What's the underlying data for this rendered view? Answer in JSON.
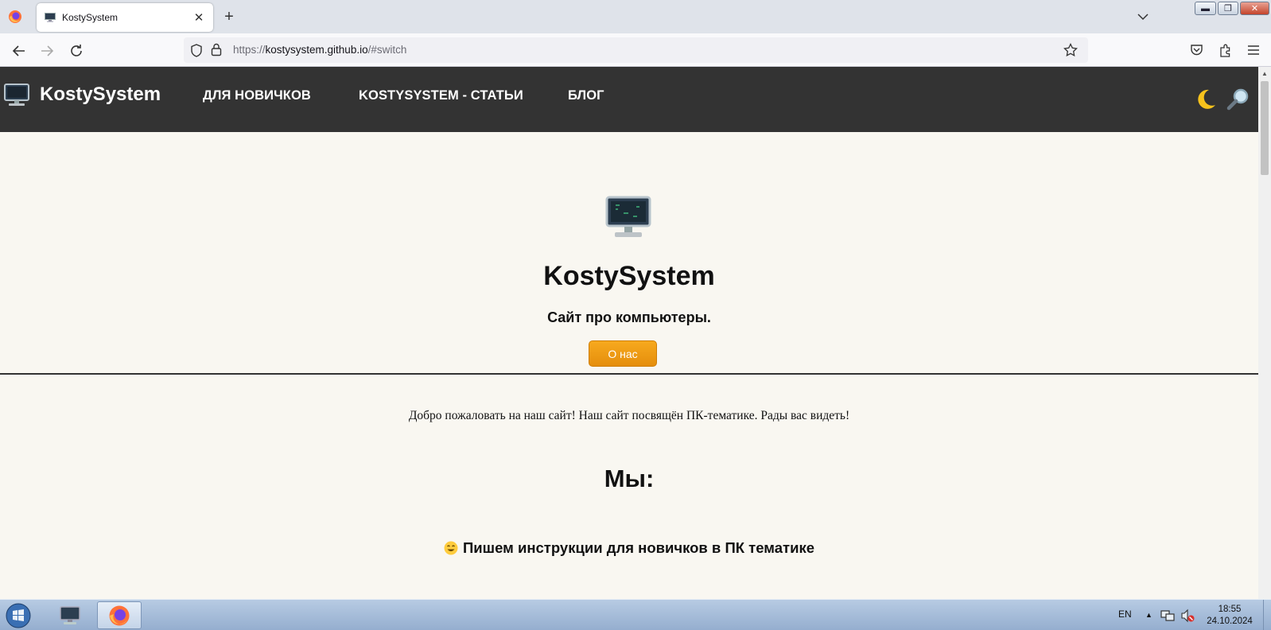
{
  "browser": {
    "tab": {
      "title": "KostySystem",
      "close_glyph": "✕"
    },
    "new_tab_glyph": "+",
    "address": {
      "scheme": "https://",
      "host": "kostysystem.github.io",
      "path": "/#switch"
    },
    "window_controls": {
      "minimize": "▬",
      "maximize": "❐",
      "close": "✕"
    }
  },
  "site": {
    "logo_text": "KostySystem",
    "nav": [
      {
        "label": "ДЛЯ НОВИЧКОВ"
      },
      {
        "label": "KOSTYSYSTEM - СТАТЬИ"
      },
      {
        "label": "БЛОГ"
      }
    ],
    "theme_icon": "moon-icon",
    "search_icon": "magnifier-icon"
  },
  "hero": {
    "icon": "desktop-computer-icon",
    "title": "KostySystem",
    "subtitle": "Сайт про компьютеры.",
    "button_label": "О нас"
  },
  "content": {
    "welcome": "Добро пожаловать на наш сайт! Наш сайт посвящён ПК-тематике. Рады вас видеть!",
    "we_title": "Мы:",
    "feature": "Пишем инструкции для новичков в ПК тематике",
    "feature_icon": "smiling-face-icon"
  },
  "taskbar": {
    "language": "EN",
    "tray_arrow": "▲",
    "time": "18:55",
    "date": "24.10.2024"
  },
  "colors": {
    "header_bg": "#333333",
    "page_bg": "#f9f7f1",
    "button_accent": "#f29e12"
  }
}
